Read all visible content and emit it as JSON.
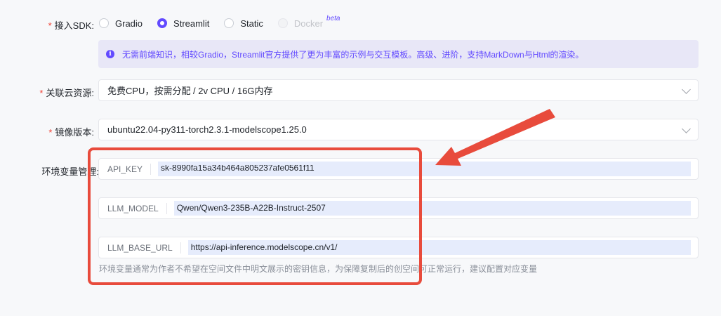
{
  "sdk": {
    "label": "接入SDK:",
    "options": [
      {
        "label": "Gradio",
        "checked": false,
        "disabled": false
      },
      {
        "label": "Streamlit",
        "checked": true,
        "disabled": false
      },
      {
        "label": "Static",
        "checked": false,
        "disabled": false
      },
      {
        "label": "Docker",
        "checked": false,
        "disabled": true
      }
    ],
    "beta": "beta"
  },
  "info": {
    "icon": "info-icon",
    "text": "无需前端知识，相较Gradio，Streamlit官方提供了更为丰富的示例与交互模板。高级、进阶，支持MarkDown与Html的渲染。"
  },
  "resource": {
    "label": "关联云资源:",
    "value": "免费CPU，按需分配 / 2v CPU / 16G内存"
  },
  "image": {
    "label": "镜像版本:",
    "value": "ubuntu22.04-py311-torch2.3.1-modelscope1.25.0"
  },
  "env": {
    "label": "环境变量管理:",
    "vars": [
      {
        "key": "API_KEY",
        "value": "sk-8990fa15a34b464a805237afe0561f11"
      },
      {
        "key": "LLM_MODEL",
        "value": "Qwen/Qwen3-235B-A22B-Instruct-2507"
      },
      {
        "key": "LLM_BASE_URL",
        "value": "https://api-inference.modelscope.cn/v1/"
      }
    ],
    "hint": "环境变量通常为作者不希望在空间文件中明文展示的密钥信息，为保障复制后的创空间可正常运行，建议配置对应变量"
  },
  "colors": {
    "accent": "#624aff",
    "annotation": "#e84b3c",
    "required": "#f04134"
  }
}
